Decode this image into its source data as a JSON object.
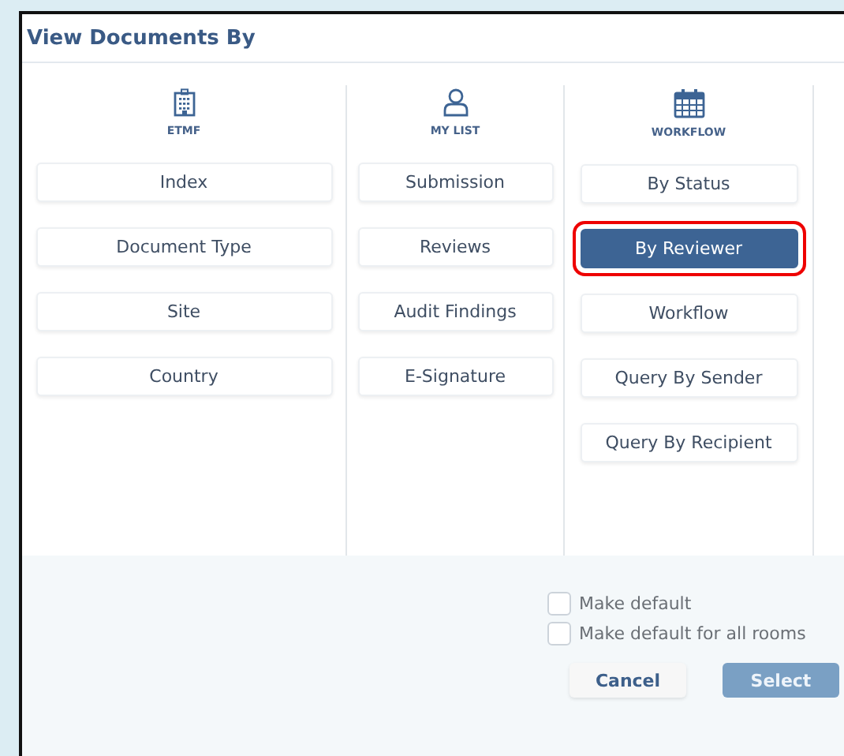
{
  "dialog": {
    "title": "View Documents By"
  },
  "columns": [
    {
      "heading": "ETMF",
      "options": [
        {
          "label": "Index",
          "selected": false
        },
        {
          "label": "Document Type",
          "selected": false
        },
        {
          "label": "Site",
          "selected": false
        },
        {
          "label": "Country",
          "selected": false
        }
      ]
    },
    {
      "heading": "MY LIST",
      "options": [
        {
          "label": "Submission",
          "selected": false
        },
        {
          "label": "Reviews",
          "selected": false
        },
        {
          "label": "Audit Findings",
          "selected": false
        },
        {
          "label": "E-Signature",
          "selected": false
        }
      ]
    },
    {
      "heading": "WORKFLOW",
      "options": [
        {
          "label": "By Status",
          "selected": false
        },
        {
          "label": "By Reviewer",
          "selected": true
        },
        {
          "label": "Workflow",
          "selected": false
        },
        {
          "label": "Query By Sender",
          "selected": false
        },
        {
          "label": "Query By Recipient",
          "selected": false
        }
      ]
    }
  ],
  "checkboxes": [
    {
      "label": "Make default",
      "checked": false
    },
    {
      "label": "Make default for all rooms",
      "checked": false
    }
  ],
  "buttons": [
    {
      "label": "Cancel",
      "kind": "secondary"
    },
    {
      "label": "Select",
      "kind": "primary",
      "disabled": true
    }
  ]
}
